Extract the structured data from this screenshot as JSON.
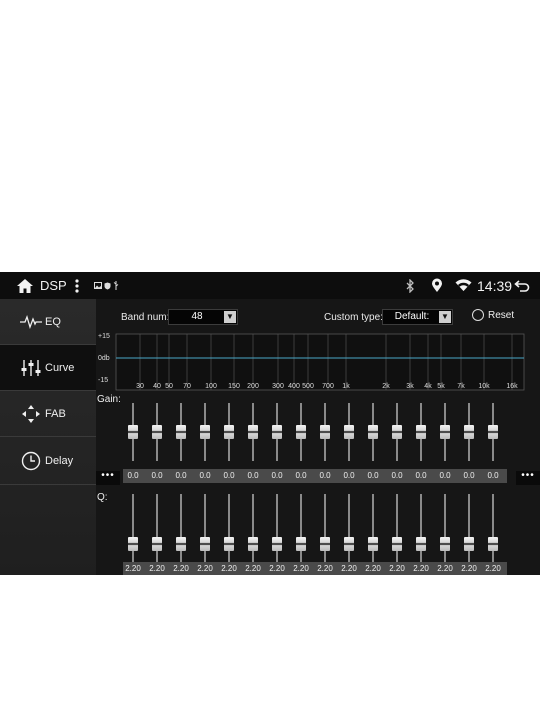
{
  "status_bar": {
    "app_title": "DSP",
    "time": "14:39",
    "icons": [
      "home-icon",
      "more-vert-icon",
      "image-icon",
      "shield-icon",
      "usb-icon",
      "bluetooth-icon",
      "location-icon",
      "wifi-icon",
      "back-icon"
    ]
  },
  "sidebar": {
    "items": [
      {
        "label": "EQ",
        "icon": "waveform-icon",
        "active": false
      },
      {
        "label": "Curve",
        "icon": "sliders-icon",
        "active": true
      },
      {
        "label": "FAB",
        "icon": "fader-balance-icon",
        "active": false
      },
      {
        "label": "Delay",
        "icon": "clock-icon",
        "active": false
      }
    ]
  },
  "controls": {
    "band_num_label": "Band num:",
    "band_num_value": "48",
    "custom_type_label": "Custom type:",
    "custom_type_value": "Default:",
    "reset_label": "Reset"
  },
  "curve": {
    "y_ticks": [
      "+15",
      "0db",
      "-15"
    ],
    "x_ticks": [
      "30",
      "40",
      "50",
      "70",
      "100",
      "150",
      "200",
      "300",
      "400",
      "500",
      "700",
      "1k",
      "2k",
      "3k",
      "4k",
      "5k",
      "7k",
      "10k",
      "16k"
    ]
  },
  "gain": {
    "label": "Gain:",
    "more_label": "•••",
    "values": [
      "0.0",
      "0.0",
      "0.0",
      "0.0",
      "0.0",
      "0.0",
      "0.0",
      "0.0",
      "0.0",
      "0.0",
      "0.0",
      "0.0",
      "0.0",
      "0.0",
      "0.0",
      "0.0"
    ],
    "levels": [
      0.5,
      0.5,
      0.5,
      0.5,
      0.5,
      0.5,
      0.5,
      0.5,
      0.5,
      0.5,
      0.5,
      0.5,
      0.5,
      0.5,
      0.5,
      0.5
    ]
  },
  "q": {
    "label": "Q:",
    "values": [
      "2.20",
      "2.20",
      "2.20",
      "2.20",
      "2.20",
      "2.20",
      "2.20",
      "2.20",
      "2.20",
      "2.20",
      "2.20",
      "2.20",
      "2.20",
      "2.20",
      "2.20",
      "2.20"
    ],
    "levels": [
      0.2,
      0.2,
      0.2,
      0.2,
      0.2,
      0.2,
      0.2,
      0.2,
      0.2,
      0.2,
      0.2,
      0.2,
      0.2,
      0.2,
      0.2,
      0.2
    ]
  },
  "colors": {
    "background": "#1b1b1b",
    "curve_line": "#4aa8c8",
    "grid": "#5a5a5a"
  }
}
